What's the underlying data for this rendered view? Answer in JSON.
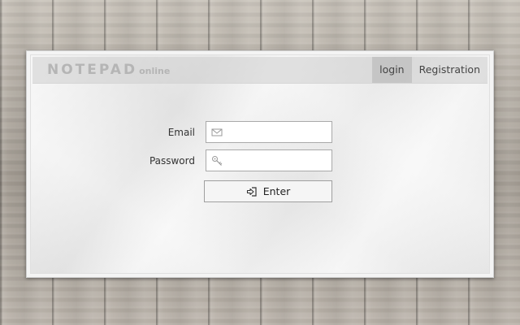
{
  "app": {
    "logo_main": "NOTEPAD",
    "logo_sub": "online"
  },
  "nav": {
    "login_label": "login",
    "registration_label": "Registration"
  },
  "form": {
    "email_label": "Email",
    "email_value": "",
    "email_icon": "envelope-icon",
    "password_label": "Password",
    "password_value": "",
    "password_icon": "key-icon",
    "enter_label": "Enter",
    "enter_icon": "sign-in-icon"
  }
}
